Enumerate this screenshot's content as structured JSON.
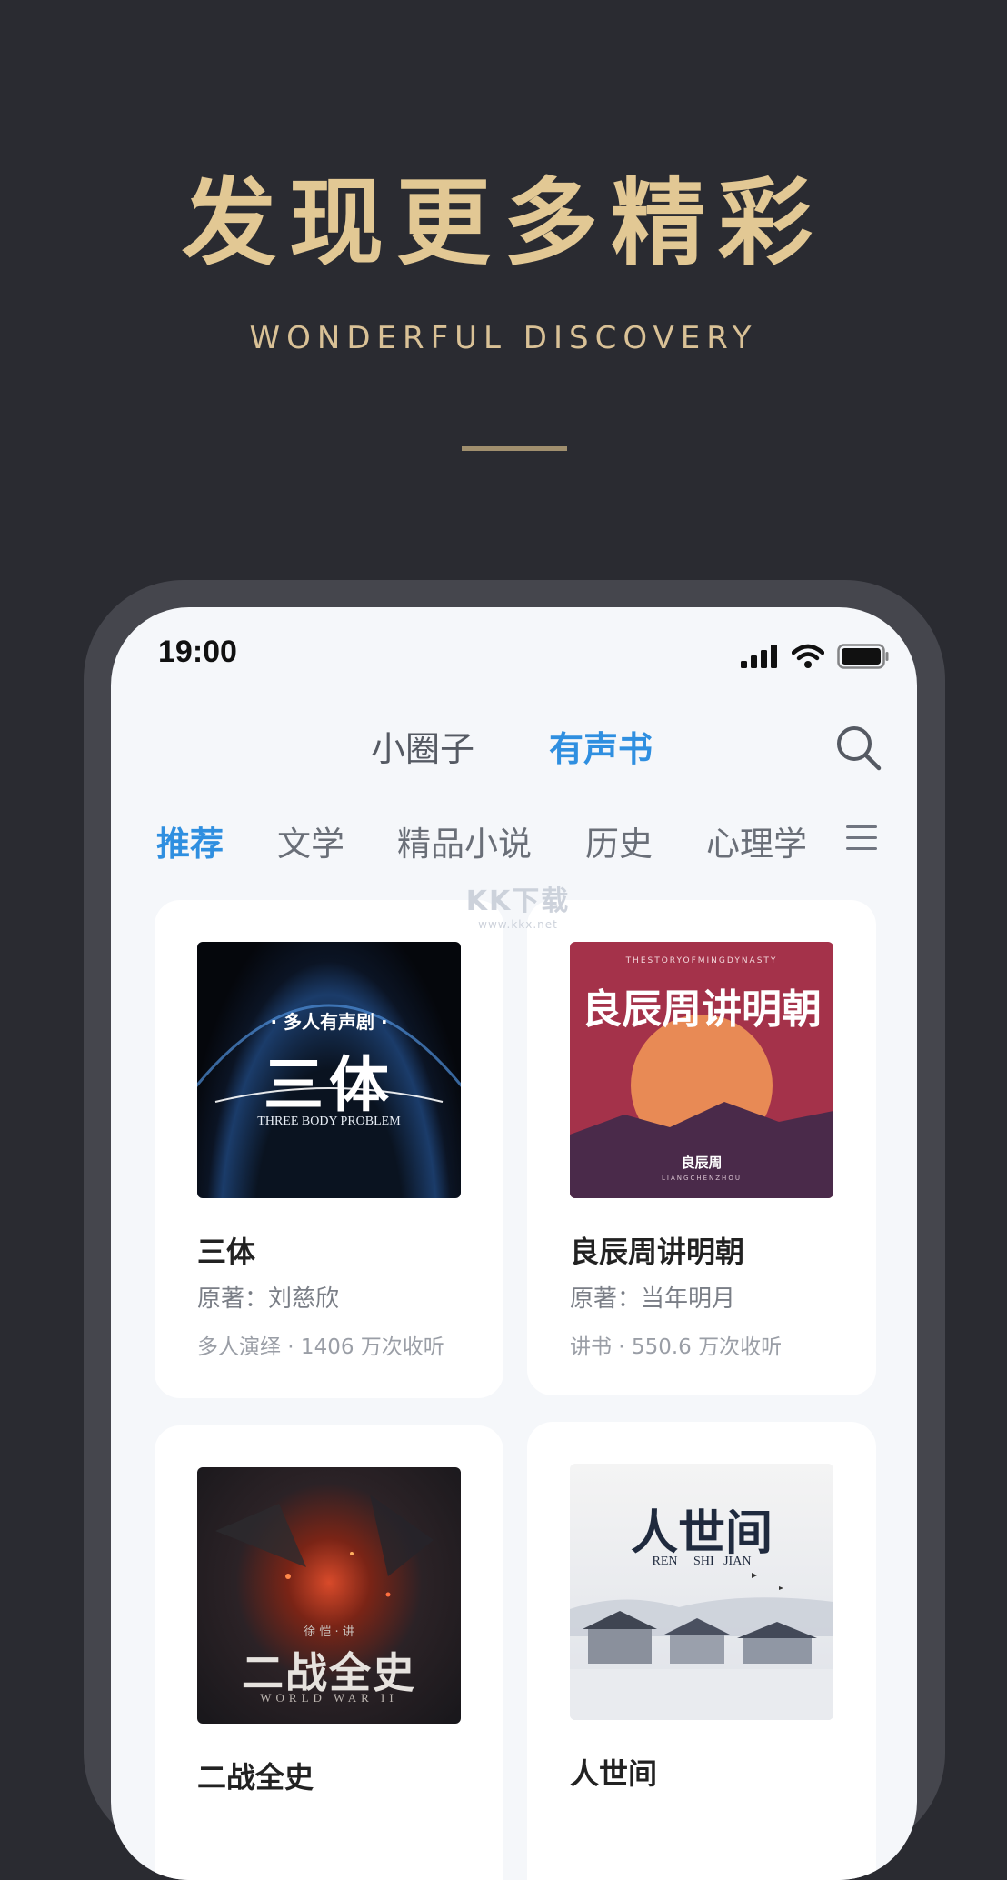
{
  "hero": {
    "title": "发现更多精彩",
    "subtitle": "WONDERFUL DISCOVERY"
  },
  "status": {
    "time": "19:00"
  },
  "top_tabs": [
    {
      "label": "小圈子",
      "active": false
    },
    {
      "label": "有声书",
      "active": true
    }
  ],
  "categories": [
    {
      "label": "推荐",
      "active": true
    },
    {
      "label": "文学"
    },
    {
      "label": "精品小说"
    },
    {
      "label": "历史"
    },
    {
      "label": "心理学"
    }
  ],
  "icons": {
    "search": "search-icon",
    "menu": "hamburger-menu-icon",
    "signal": "signal-icon",
    "wifi": "wifi-icon",
    "battery": "battery-icon"
  },
  "colors": {
    "accent": "#2f8fe0",
    "gold": "#e2c894",
    "background": "#2a2b31"
  },
  "books": [
    {
      "title": "三体",
      "author": "原著：刘慈欣",
      "stats": "多人演绎 · 1406 万次收听",
      "cover": {
        "top_text": "· 多人有声剧 ·",
        "main_text": "三体",
        "sub_text": "THREE BODY PROBLEM"
      }
    },
    {
      "title": "良辰周讲明朝",
      "author": "原著：当年明月",
      "stats": "讲书 · 550.6 万次收听",
      "cover": {
        "top_text": "THESTORYOFMINGDYNASTY",
        "main_text": "良辰周讲明朝",
        "sub_text": "良辰周",
        "sub_small": "LIANGCHENZHOU"
      }
    },
    {
      "title": "二战全史",
      "cover": {
        "top_text": "徐 恺 · 讲",
        "main_text": "二战全史",
        "sub_text": "WORLD WAR II"
      }
    },
    {
      "title": "人世间",
      "cover": {
        "main_text": "人世间",
        "sub_text": "REN     SHI   JIAN"
      }
    }
  ],
  "watermark": {
    "main": "KK下载",
    "sub": "www.kkx.net"
  }
}
